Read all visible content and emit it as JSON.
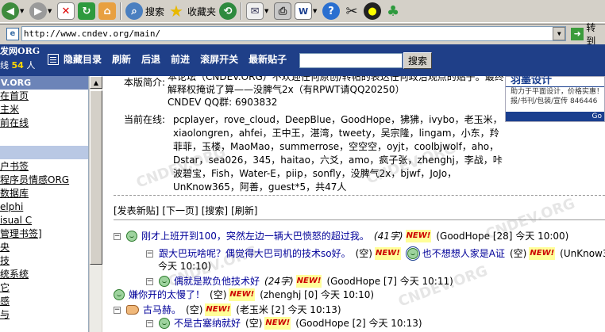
{
  "toolbar": {
    "search_label": "搜索",
    "favorites_label": "收藏夹"
  },
  "address": {
    "url": "http://www.cndev.org/main/",
    "go_label": "转到"
  },
  "site": {
    "brand_title": "发网ORG",
    "brand_online_prefix": "线",
    "brand_online_count": "54",
    "brand_online_suffix": "人",
    "nav": [
      "隐藏目录",
      "刷新",
      "后退",
      "前进",
      "滚屏开关",
      "最新贴子"
    ],
    "search_button": "搜索"
  },
  "sidebar": {
    "header": "V.ORG",
    "items_top": [
      "在首页",
      "主米",
      "前在线"
    ],
    "items_bottom": [
      "户书签",
      "程序员情感ORG",
      "数据库",
      "elphi",
      "isual C",
      "管理书签]",
      "央",
      "技",
      "统系统",
      "它",
      "感",
      "与"
    ]
  },
  "intro": {
    "key": "本版简介:",
    "text": "本论坛（CNDEV.ORG）不欢迎任何原创/转帖的表达任何政治观点的贴子。最终解释权掩说了算——没脾气2x（有RPWT请QQ20250）",
    "qq": "CNDEV QQ群: 6903832"
  },
  "online": {
    "key": "当前在线:",
    "users": "pcplayer，rove_cloud，DeepBlue，GoodHope，狒狒，ivybo，老玉米，xiaolongren，ahfei，王中王，湛湾，tweety，吴宗隆，lingam，小东，羚菲菲，玉楼，MaoMao，summerrose，空空空，oyjt，coolbjwolf，aho，Dstar，sea026，345，haitao，六爻，amo，疯子张，zhenghj，李战，咔波碧宝，Fish，Water-E，piip，sonfly，没脾气2x，bjwf，JoJo，UnKnow365，阿善，guest*5，共47人"
  },
  "ad": {
    "title": "羽墨设计",
    "line1": "助力于平面设计，价格实惠！",
    "line2": "报/书刊/包装/宣传 846446",
    "bar": "Go"
  },
  "actions": [
    "[发表新贴]",
    "[下一页]",
    "[搜索]",
    "[刷新]"
  ],
  "new_label": "NEW!",
  "threads": [
    {
      "title": "刚才上班开到100，突然左边一辆大巴愤怒的超过我。",
      "meta": "(41字)",
      "author": "(GoodHope [28] 今天 10:00)"
    },
    {
      "title": "跟大巴玩啥呢？偶觉得大巴司机的技术so好。",
      "meta": "(空)",
      "author": ""
    },
    {
      "title": "也不想想人家是A证",
      "meta": "(空)",
      "author": "(UnKnow365"
    },
    {
      "title": "",
      "meta": "",
      "author": "今天 10:10)"
    },
    {
      "title": "偶就是欺负他技术好",
      "meta": "(24字)",
      "author": "(GoodHope [7] 今天 10:11)"
    },
    {
      "title": "嫌你开的太慢了！",
      "meta": "(空)",
      "author": "(zhenghj [0] 今天 10:10)"
    },
    {
      "title": "古马赫。",
      "meta": "(空)",
      "author": "(老玉米 [2] 今天 10:13)"
    },
    {
      "title": "不是古塞纳就好",
      "meta": "(空)",
      "author": "(GoodHope [2] 今天 10:13)"
    }
  ],
  "watermark": "CNDEV.ORG"
}
